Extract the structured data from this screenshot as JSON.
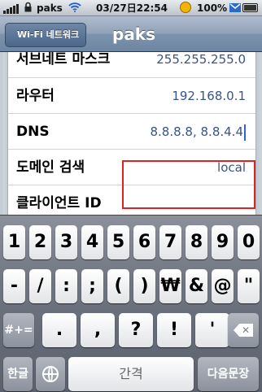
{
  "status_bar": {
    "carrier": "paks",
    "time": "03/27日22:54",
    "battery_percent": "100%"
  },
  "nav": {
    "back_label": "Wi-Fi 네트워크",
    "title": "paks"
  },
  "settings_rows": [
    {
      "label": "서브네트 마스크",
      "value": "255.255.255.0"
    },
    {
      "label": "라우터",
      "value": "192.168.0.1"
    },
    {
      "label": "DNS",
      "value": "8.8.8.8, 8.8.4.4"
    },
    {
      "label": "도메인 검색",
      "value": "local"
    },
    {
      "label": "클라이언트 ID",
      "value": ""
    }
  ],
  "keyboard": {
    "row1": [
      "1",
      "2",
      "3",
      "4",
      "5",
      "6",
      "7",
      "8",
      "9",
      "0"
    ],
    "row2": [
      "-",
      "/",
      ":",
      ";",
      "(",
      ")",
      "₩",
      "&",
      "@",
      "\""
    ],
    "row3_shift": "#+=",
    "row3": [
      ".",
      ",",
      "?",
      "!",
      "'"
    ],
    "lang_key": "한글",
    "space_label": "간격",
    "return_label": "다음문장"
  }
}
